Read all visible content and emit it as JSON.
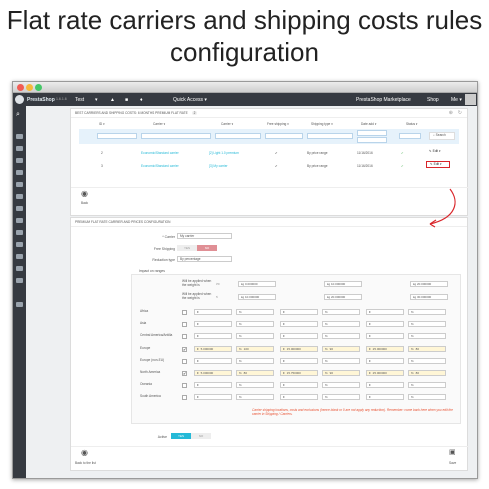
{
  "headline": "Flat rate carriers and shipping costs rules configuration",
  "browser": {
    "dots": [
      "#f25c54",
      "#f6b93b",
      "#44c767"
    ]
  },
  "topnav": {
    "logo": "PrestaShop",
    "version": "1.6.1.6",
    "shop_name": "Test",
    "quick_access": "Quick Access ▾",
    "marketplace": "PrestaShop Marketplace",
    "shop_link": "Shop",
    "me": "Me ▾"
  },
  "list_panel": {
    "header": "BEST CARRIERS AND SHIPPING COSTS: 6 MONTHS PREMIUM FLAT RATE",
    "count": "2",
    "columns": [
      "ID ▾",
      "Carrier ▾",
      "Carrier ▾",
      "Free shipping ▾",
      "Shipping type ▾",
      "Date add ▾",
      "Status ▾"
    ],
    "search_label": "Search",
    "rows": [
      {
        "id": "2",
        "carrier_name": "Economic/Standard carrier",
        "carrier": "[2] Light 1.0 premium",
        "free": "✔",
        "type": "By price range",
        "date": "11/16/2016",
        "status": "✔",
        "action": "Edit"
      },
      {
        "id": "3",
        "carrier_name": "Economic/Standard carrier",
        "carrier": "[3] My carrier",
        "free": "✔",
        "type": "By price range",
        "date": "11/16/2016",
        "status": "✔",
        "action": "Edit"
      }
    ],
    "back_label": "Back"
  },
  "config": {
    "header": "PREMIUM FLAT RATE CARRIER AND PRICES CONFIGURATION",
    "carrier_label": "* Carrier",
    "carrier_value": "My carrier",
    "free_shipping_label": "Free Shipping",
    "free_yes": "YES",
    "free_no": "NO",
    "reduction_label": "Reduction type",
    "reduction_value": "By percentage",
    "impact_label": "Impact on ranges",
    "range_label_1": "Will be applied when the weight is",
    "range_label_2": "Will be applied when the weight is",
    "range_op_1": ">=",
    "range_op_2": "<",
    "range_unit": "kg",
    "range_row1": [
      "0.000000",
      "10.000000",
      "20.000000"
    ],
    "range_row2": [
      "10.000000",
      "20.000000",
      "30.000000"
    ],
    "zones": [
      {
        "name": "Africa",
        "checked": false,
        "v": [
          "",
          "",
          "",
          "",
          "",
          ""
        ]
      },
      {
        "name": "Asia",
        "checked": false,
        "v": [
          "",
          "",
          "",
          "",
          "",
          ""
        ]
      },
      {
        "name": "Central America/Antilla",
        "checked": false,
        "v": [
          "",
          "",
          "",
          "",
          "",
          ""
        ]
      },
      {
        "name": "Europe",
        "checked": true,
        "v": [
          "5.000000",
          "100",
          "15.000000",
          "90",
          "25.000000",
          "80"
        ]
      },
      {
        "name": "Europe (non-EU)",
        "checked": false,
        "v": [
          "",
          "",
          "",
          "",
          "",
          ""
        ]
      },
      {
        "name": "North America",
        "checked": true,
        "v": [
          "5.000000",
          "80",
          "15.750000",
          "90",
          "25.000000",
          "80"
        ]
      },
      {
        "name": "Oceania",
        "checked": false,
        "v": [
          "",
          "",
          "",
          "",
          "",
          ""
        ]
      },
      {
        "name": "South America",
        "checked": false,
        "v": [
          "",
          "",
          "",
          "",
          "",
          ""
        ]
      }
    ],
    "currency": "€",
    "percent": "%",
    "warning": "Carrier shipping locations, costs and exclusions (hence blank or 0 are not apply any reduction). Remember: come back here when you edit the carrier in Shipping / Carriers.",
    "active_label": "Active",
    "active_yes": "YES",
    "active_no": "NO",
    "back_label": "Back to the list",
    "save_label": "Save"
  },
  "accent": "#25b9d7",
  "callout_color": "#d9252a"
}
